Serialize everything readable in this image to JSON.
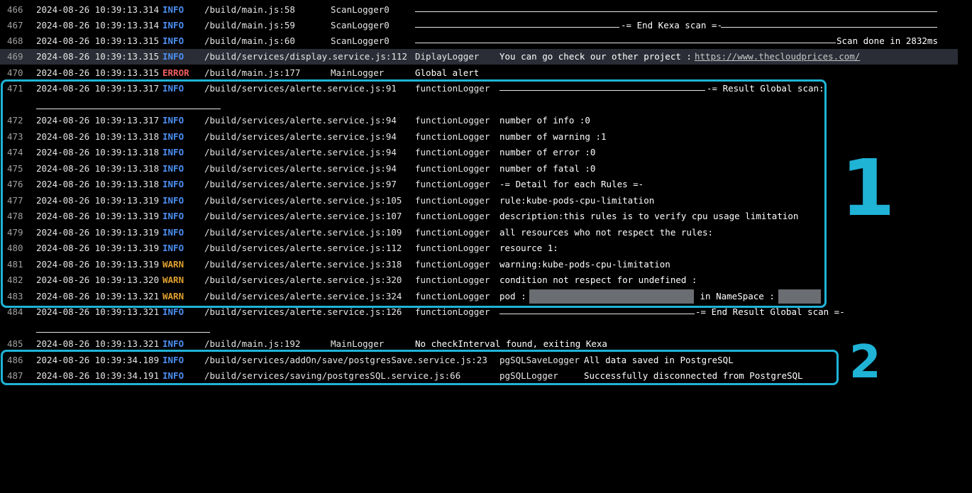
{
  "rows": [
    {
      "n": "466",
      "ts": "2024-08-26 10:39:13.314",
      "lv": "INFO",
      "src": "/build/main.js:58",
      "logger": "ScanLogger0",
      "msg": ""
    },
    {
      "n": "467",
      "ts": "2024-08-26 10:39:13.314",
      "lv": "INFO",
      "src": "/build/main.js:59",
      "logger": "ScanLogger0",
      "msg": "-= End Kexa scan =-"
    },
    {
      "n": "468",
      "ts": "2024-08-26 10:39:13.315",
      "lv": "INFO",
      "src": "/build/main.js:60",
      "logger": "ScanLogger0",
      "msg": "Scan done in 2832ms"
    },
    {
      "n": "469",
      "ts": "2024-08-26 10:39:13.315",
      "lv": "INFO",
      "src": "/build/services/display.service.js:112",
      "logger": "DiplayLogger",
      "msg": "You can go check our other project : ",
      "link": "https://www.thecloudprices.com/"
    },
    {
      "n": "470",
      "ts": "2024-08-26 10:39:13.315",
      "lv": "ERROR",
      "src": "/build/main.js:177",
      "logger": "MainLogger",
      "msg": "Global alert"
    },
    {
      "n": "471",
      "ts": "2024-08-26 10:39:13.317",
      "lv": "INFO",
      "src": "/build/services/alerte.service.js:91",
      "logger": "functionLogger",
      "msg": "-= Result Global scan:"
    },
    {
      "n": "472",
      "ts": "2024-08-26 10:39:13.317",
      "lv": "INFO",
      "src": "/build/services/alerte.service.js:94",
      "logger": "functionLogger",
      "msg": "number of info :0"
    },
    {
      "n": "473",
      "ts": "2024-08-26 10:39:13.318",
      "lv": "INFO",
      "src": "/build/services/alerte.service.js:94",
      "logger": "functionLogger",
      "msg": "number of warning :1"
    },
    {
      "n": "474",
      "ts": "2024-08-26 10:39:13.318",
      "lv": "INFO",
      "src": "/build/services/alerte.service.js:94",
      "logger": "functionLogger",
      "msg": "number of error :0"
    },
    {
      "n": "475",
      "ts": "2024-08-26 10:39:13.318",
      "lv": "INFO",
      "src": "/build/services/alerte.service.js:94",
      "logger": "functionLogger",
      "msg": "number of fatal :0"
    },
    {
      "n": "476",
      "ts": "2024-08-26 10:39:13.318",
      "lv": "INFO",
      "src": "/build/services/alerte.service.js:97",
      "logger": "functionLogger",
      "msg": "-= Detail for each Rules =-"
    },
    {
      "n": "477",
      "ts": "2024-08-26 10:39:13.319",
      "lv": "INFO",
      "src": "/build/services/alerte.service.js:105",
      "logger": "functionLogger",
      "msg": "rule:kube-pods-cpu-limitation"
    },
    {
      "n": "478",
      "ts": "2024-08-26 10:39:13.319",
      "lv": "INFO",
      "src": "/build/services/alerte.service.js:107",
      "logger": "functionLogger",
      "msg": "description:this rules is to verify cpu usage limitation"
    },
    {
      "n": "479",
      "ts": "2024-08-26 10:39:13.319",
      "lv": "INFO",
      "src": "/build/services/alerte.service.js:109",
      "logger": "functionLogger",
      "msg": "all resources who not respect the rules:"
    },
    {
      "n": "480",
      "ts": "2024-08-26 10:39:13.319",
      "lv": "INFO",
      "src": "/build/services/alerte.service.js:112",
      "logger": "functionLogger",
      "msg": "resource 1:"
    },
    {
      "n": "481",
      "ts": "2024-08-26 10:39:13.319",
      "lv": "WARN",
      "src": "/build/services/alerte.service.js:318",
      "logger": "functionLogger",
      "msg": "warning:kube-pods-cpu-limitation"
    },
    {
      "n": "482",
      "ts": "2024-08-26 10:39:13.320",
      "lv": "WARN",
      "src": "/build/services/alerte.service.js:320",
      "logger": "functionLogger",
      "msg": "condition not respect for undefined :"
    },
    {
      "n": "483",
      "ts": "2024-08-26 10:39:13.321",
      "lv": "WARN",
      "src": "/build/services/alerte.service.js:324",
      "logger": "functionLogger",
      "msg": "pod : ",
      "msg2": " in NameSpace : "
    },
    {
      "n": "484",
      "ts": "2024-08-26 10:39:13.321",
      "lv": "INFO",
      "src": "/build/services/alerte.service.js:126",
      "logger": "functionLogger",
      "msg": "-= End Result Global scan =-"
    },
    {
      "n": "485",
      "ts": "2024-08-26 10:39:13.321",
      "lv": "INFO",
      "src": "/build/main.js:192",
      "logger": "MainLogger",
      "msg": "No checkInterval found, exiting Kexa"
    },
    {
      "n": "486",
      "ts": "2024-08-26 10:39:34.189",
      "lv": "INFO",
      "src": "/build/services/addOn/save/postgresSave.service.js:23",
      "logger": "pgSQLSaveLogger",
      "msg": "All data saved in PostgreSQL"
    },
    {
      "n": "487",
      "ts": "2024-08-26 10:39:34.191",
      "lv": "INFO",
      "src": "/build/services/saving/postgresSQL.service.js:66",
      "logger": "pgSQLLogger",
      "msg": "Successfully disconnected from PostgreSQL"
    }
  ],
  "callouts": [
    "1",
    "2"
  ],
  "colors": {
    "accent": "#1fb3d6",
    "info": "#4c8ff2",
    "warn": "#e0a030",
    "error": "#f06060"
  }
}
